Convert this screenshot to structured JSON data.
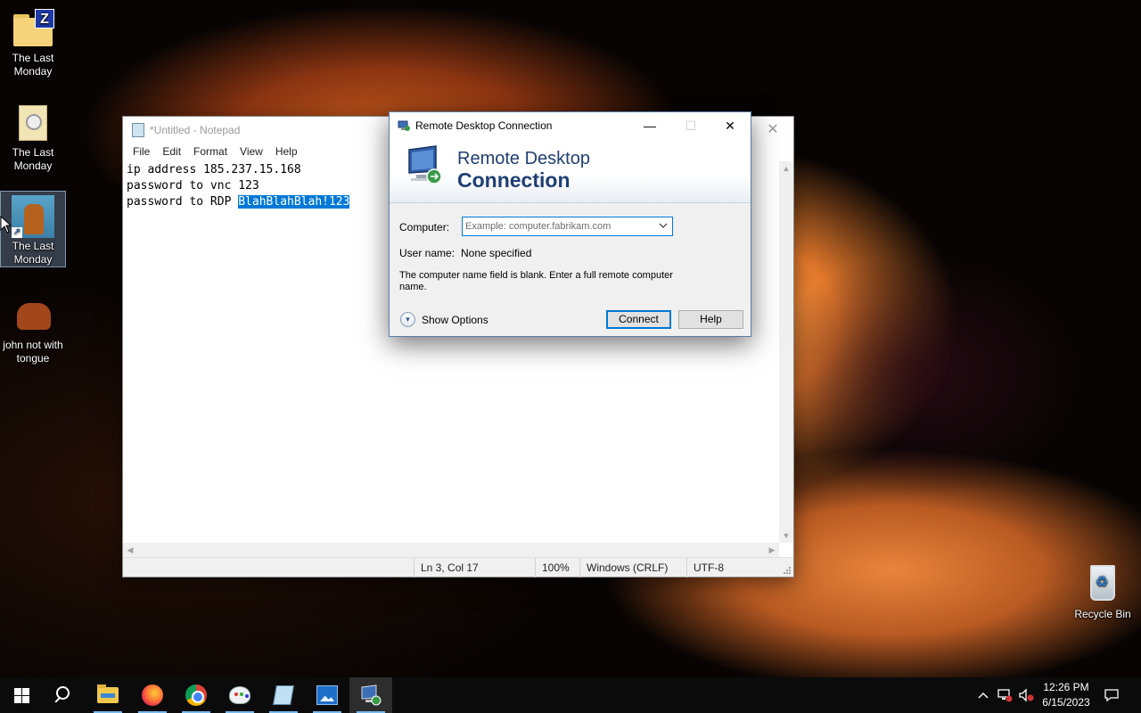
{
  "desktop": {
    "icons": [
      {
        "label": "The Last Monday"
      },
      {
        "label": "The Last Monday"
      },
      {
        "label": "The Last Monday"
      },
      {
        "label": "john not with tongue"
      },
      {
        "label": "Recycle Bin"
      }
    ]
  },
  "notepad": {
    "title": "*Untitled - Notepad",
    "menu": [
      "File",
      "Edit",
      "Format",
      "View",
      "Help"
    ],
    "lines": [
      "ip address 185.237.15.168",
      "password to vnc 123"
    ],
    "line3_prefix": "password to RDP ",
    "line3_selected": "BlahBlahBlah!123",
    "status": {
      "position": "Ln 3, Col 17",
      "zoom": "100%",
      "line_ending": "Windows (CRLF)",
      "encoding": "UTF-8"
    }
  },
  "rdc": {
    "title": "Remote Desktop Connection",
    "banner_line1": "Remote Desktop",
    "banner_line2": "Connection",
    "computer_label": "Computer:",
    "computer_value": "",
    "computer_placeholder": "Example: computer.fabrikam.com",
    "username_label": "User name:",
    "username_value": "None specified",
    "message": "The computer name field is blank. Enter a full remote computer name.",
    "show_options": "Show Options",
    "connect": "Connect",
    "help": "Help"
  },
  "taskbar": {
    "apps": [
      "start-icon",
      "search-icon",
      "file-explorer-icon",
      "firefox-icon",
      "chrome-icon",
      "paint-icon",
      "notepad-icon",
      "photos-icon",
      "remote-desktop-icon"
    ],
    "clock_time": "12:26 PM",
    "clock_date": "6/15/2023"
  },
  "colors": {
    "selection": "#0078d7",
    "banner_text": "#1f3f73",
    "taskbar": "#0b0b0c"
  }
}
